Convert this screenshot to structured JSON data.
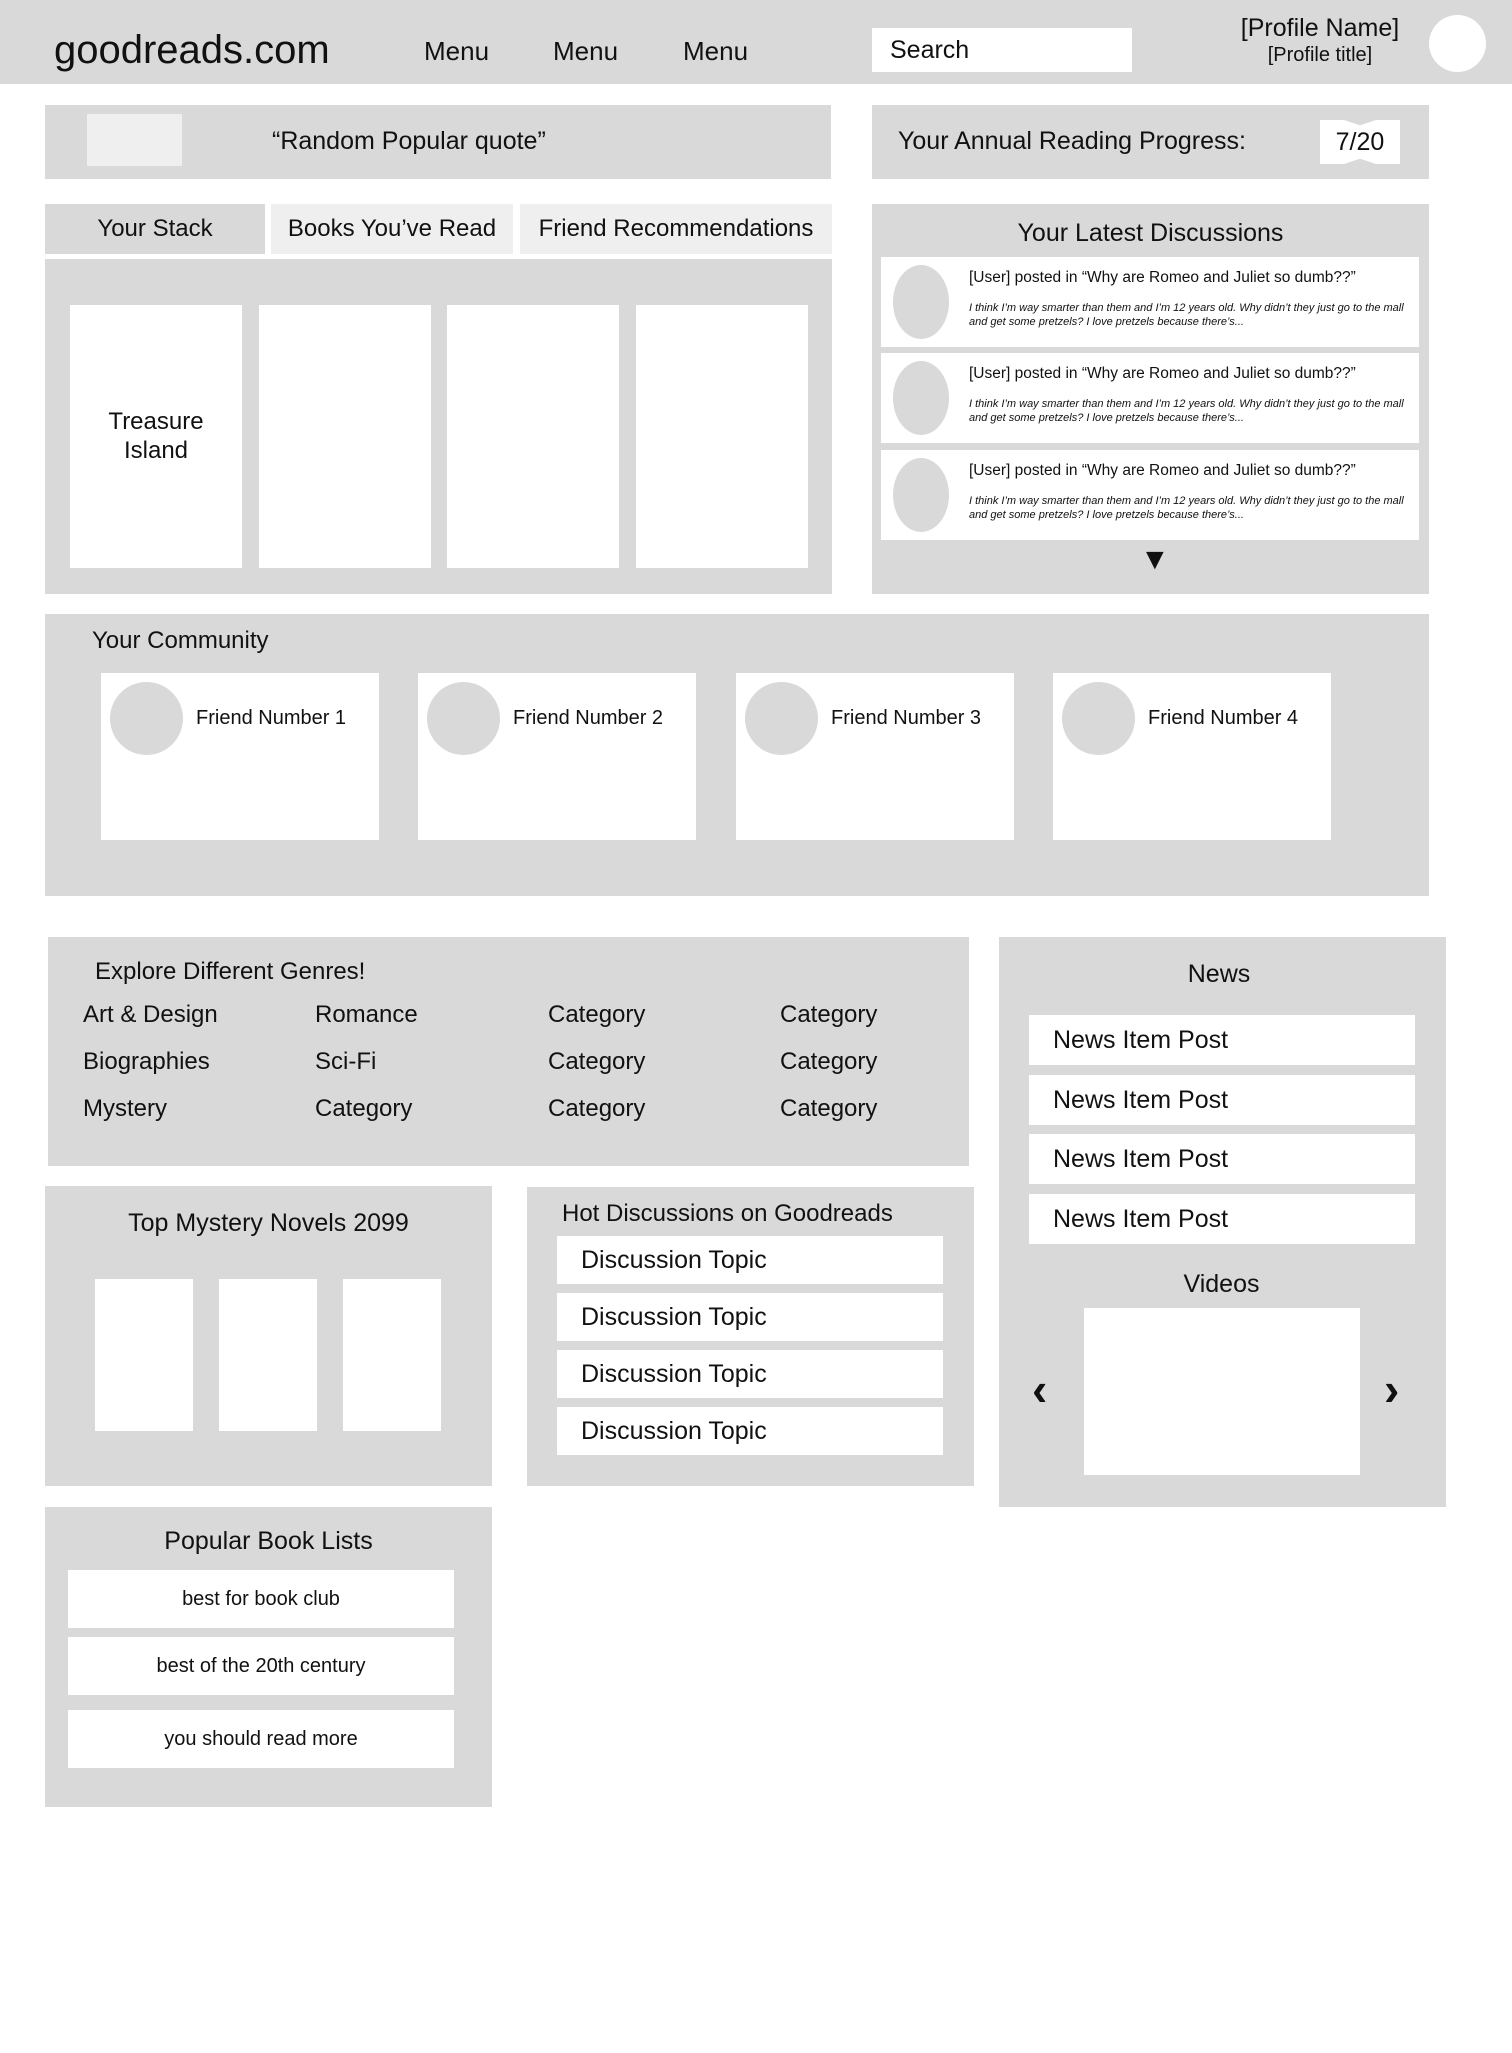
{
  "header": {
    "logo": "goodreads.com",
    "menu": [
      "Menu",
      "Menu",
      "Menu"
    ],
    "search_label": "Search",
    "profile_name": "[Profile Name]",
    "profile_title": "[Profile title]"
  },
  "quote": {
    "text": "“Random Popular quote”"
  },
  "progress": {
    "label": "Your Annual Reading Progress:",
    "value": "7/20",
    "read": 7,
    "goal": 20
  },
  "tabs": [
    "Your Stack",
    "Books You’ve Read",
    "Friend Recommendations"
  ],
  "stack": {
    "books": [
      "Treasure Island",
      "",
      "",
      ""
    ]
  },
  "latest_discussions": {
    "title": "Your Latest Discussions",
    "items": [
      {
        "head": "[User] posted in “Why are Romeo and Juliet so dumb??”",
        "body": "I think I’m way smarter than them and I’m 12 years old. Why didn’t they just go to the mall and get some pretzels? I love pretzels because there’s..."
      },
      {
        "head": "[User] posted in “Why are Romeo and Juliet so dumb??”",
        "body": "I think I’m way smarter than them and I’m 12 years old. Why didn’t they just go to the mall and get some pretzels? I love pretzels because there’s..."
      },
      {
        "head": "[User] posted in “Why are Romeo and Juliet so dumb??”",
        "body": "I think I’m way smarter than them and I’m 12 years old. Why didn’t they just go to the mall and get some pretzels? I love pretzels because there’s..."
      }
    ],
    "more_glyph": "▼"
  },
  "community": {
    "title": "Your Community",
    "friends": [
      "Friend Number 1",
      "Friend Number 2",
      "Friend Number 3",
      "Friend Number 4"
    ]
  },
  "genres": {
    "title": "Explore Different Genres!",
    "columns": [
      [
        "Art & Design",
        "Biographies",
        "Mystery"
      ],
      [
        "Romance",
        "Sci-Fi",
        "Category"
      ],
      [
        "Category",
        "Category",
        "Category"
      ],
      [
        "Category",
        "Category",
        "Category"
      ]
    ]
  },
  "news": {
    "title": "News",
    "items": [
      "News Item Post",
      "News Item Post",
      "News Item Post",
      "News Item Post"
    ],
    "videos_title": "Videos",
    "prev_glyph": "‹",
    "next_glyph": "›"
  },
  "mystery": {
    "title": "Top Mystery Novels 2099"
  },
  "hot_discussions": {
    "title": "Hot Discussions on Goodreads",
    "topics": [
      "Discussion Topic",
      "Discussion Topic",
      "Discussion Topic",
      "Discussion Topic"
    ]
  },
  "book_lists": {
    "title": "Popular Book Lists",
    "items": [
      "best for book club",
      "best of the 20th century",
      "you should read more"
    ]
  }
}
